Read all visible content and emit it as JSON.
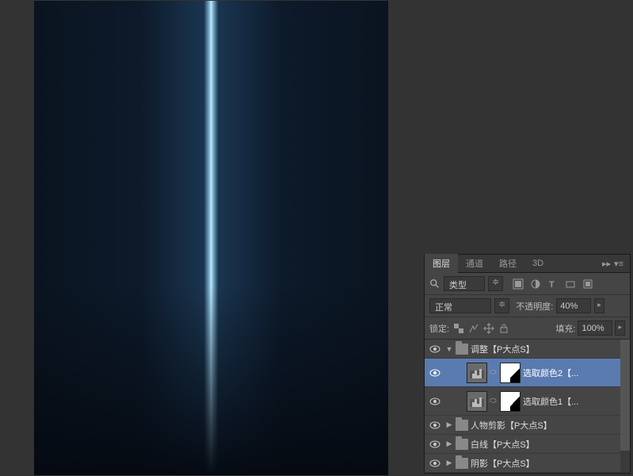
{
  "tabs": {
    "layers": "图层",
    "channels": "通道",
    "paths": "路径",
    "three_d": "3D"
  },
  "filter": {
    "type_label": "类型"
  },
  "blend": {
    "mode": "正常",
    "opacity_label": "不透明度:",
    "opacity_value": "40%"
  },
  "lock": {
    "label": "锁定:",
    "fill_label": "填充:",
    "fill_value": "100%"
  },
  "layers": [
    {
      "name": "调整【P大点S】",
      "type": "group",
      "expanded": true
    },
    {
      "name": "选取颜色2【...",
      "type": "adjustment",
      "selected": true
    },
    {
      "name": "选取颜色1【...",
      "type": "adjustment"
    },
    {
      "name": "人物剪影【P大点S】",
      "type": "group",
      "expanded": false
    },
    {
      "name": "白线【P大点S】",
      "type": "group",
      "expanded": false
    },
    {
      "name": "阴影【P大点S】",
      "type": "group",
      "expanded": false
    }
  ]
}
